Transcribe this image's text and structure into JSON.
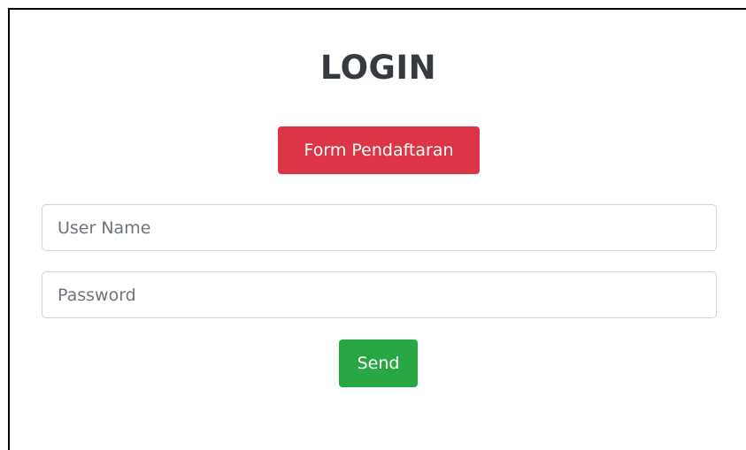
{
  "page": {
    "title": "LOGIN"
  },
  "register_button": {
    "label": "Form Pendaftaran",
    "color": "#dc3545"
  },
  "username": {
    "value": "",
    "placeholder": "User Name"
  },
  "password": {
    "value": "",
    "placeholder": "Password"
  },
  "send_button": {
    "label": "Send",
    "color": "#28a745"
  }
}
